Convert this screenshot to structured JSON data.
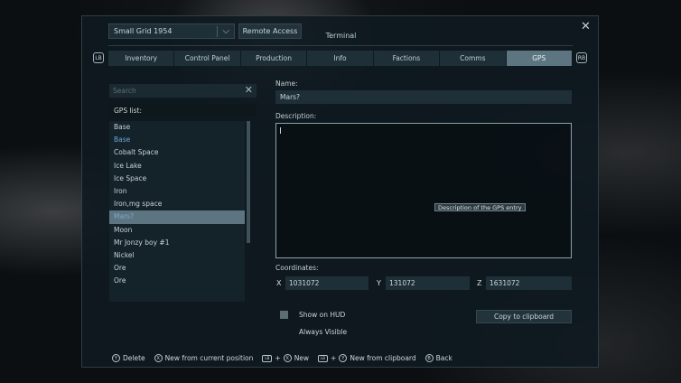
{
  "header": {
    "grid_select": "Small Grid 1954",
    "remote_access": "Remote Access",
    "title": "Terminal",
    "lb": "LB",
    "rb": "RB"
  },
  "tabs": [
    {
      "label": "Inventory"
    },
    {
      "label": "Control Panel"
    },
    {
      "label": "Production"
    },
    {
      "label": "Info"
    },
    {
      "label": "Factions"
    },
    {
      "label": "Comms"
    },
    {
      "label": "GPS"
    }
  ],
  "active_tab": "GPS",
  "left": {
    "search_placeholder": "Search",
    "gps_list_label": "GPS list:",
    "items": [
      {
        "label": "Base"
      },
      {
        "label": "Base"
      },
      {
        "label": "Cobalt Space"
      },
      {
        "label": "Ice Lake"
      },
      {
        "label": "Ice Space"
      },
      {
        "label": "Iron"
      },
      {
        "label": "Iron,mg space"
      },
      {
        "label": "Mars?"
      },
      {
        "label": "Moon"
      },
      {
        "label": "Mr Jonzy boy #1"
      },
      {
        "label": "Nickel"
      },
      {
        "label": "Ore"
      },
      {
        "label": "Ore"
      }
    ],
    "selected_index": 7
  },
  "right": {
    "name_label": "Name:",
    "name_value": "Mars?",
    "description_label": "Description:",
    "description_value": "",
    "tooltip": "Description of the GPS entry",
    "coordinates_label": "Coordinates:",
    "x_label": "X",
    "x_value": "1031072",
    "y_label": "Y",
    "y_value": "131072",
    "z_label": "Z",
    "z_value": "1631072",
    "show_on_hud": "Show on HUD",
    "show_on_hud_checked": false,
    "always_visible": "Always Visible",
    "always_visible_checked": false,
    "copy_button": "Copy to clipboard"
  },
  "footer": {
    "y_glyph": "Y",
    "x_glyph": "X",
    "a_glyph": "A",
    "b_glyph": "B",
    "delete": "Delete",
    "new_from_position": "New from current position",
    "new": "New",
    "new_from_clipboard": "New from clipboard",
    "back": "Back",
    "plus": "+",
    "lb_glyph": "LB"
  },
  "colors": {
    "panel": "#0e1a20",
    "tab": "#1f2f37",
    "tab_active": "#5c7580",
    "list_highlight": "#6fa3d8"
  }
}
